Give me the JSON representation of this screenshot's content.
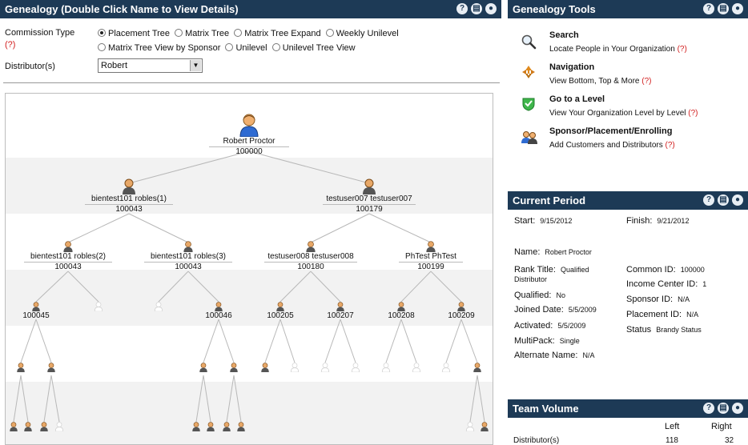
{
  "genealogy": {
    "title": "Genealogy (Double Click Name to View Details)",
    "commission_type_label": "Commission Type",
    "help": "(?)",
    "radios": [
      {
        "label": "Placement Tree",
        "selected": true
      },
      {
        "label": "Matrix Tree",
        "selected": false
      },
      {
        "label": "Matrix Tree Expand",
        "selected": false
      },
      {
        "label": "Weekly Unilevel",
        "selected": false
      },
      {
        "label": "Matrix Tree View by Sponsor",
        "selected": false
      },
      {
        "label": "Unilevel",
        "selected": false
      },
      {
        "label": "Unilevel Tree View",
        "selected": false
      }
    ],
    "distributor_label": "Distributor(s)",
    "distributor_value": "Robert"
  },
  "tree": {
    "root": {
      "name": "Robert Proctor",
      "id": "100000"
    },
    "level1": [
      {
        "name": "bientest101 robles(1)",
        "id": "100043"
      },
      {
        "name": "testuser007 testuser007",
        "id": "100179"
      }
    ],
    "level2": [
      {
        "name": "bientest101 robles(2)",
        "id": "100043"
      },
      {
        "name": "bientest101 robles(3)",
        "id": "100043"
      },
      {
        "name": "testuser008 testuser008",
        "id": "100180"
      },
      {
        "name": "PhTest PhTest",
        "id": "100199"
      }
    ],
    "level3_ids": [
      "100045",
      "100046",
      "100205",
      "100207",
      "100208",
      "100209"
    ]
  },
  "tools": {
    "title": "Genealogy Tools",
    "items": [
      {
        "icon": "search-icon",
        "title": "Search",
        "desc": "Locate People in Your Organization"
      },
      {
        "icon": "navigation-icon",
        "title": "Navigation",
        "desc": "View Bottom, Top & More"
      },
      {
        "icon": "level-icon",
        "title": "Go to a Level",
        "desc": "View Your Organization Level by Level"
      },
      {
        "icon": "people-icon",
        "title": "Sponsor/Placement/Enrolling",
        "desc": "Add Customers and Distributors"
      }
    ]
  },
  "current_period": {
    "title": "Current Period",
    "start_label": "Start:",
    "start_value": "9/15/2012",
    "finish_label": "Finish:",
    "finish_value": "9/21/2012",
    "name_label": "Name:",
    "name_value": "Robert Proctor",
    "rank_label": "Rank Title:",
    "rank_value": "Qualified",
    "rank_value2": "Distributor",
    "qualified_label": "Qualified:",
    "qualified_value": "No",
    "joined_label": "Joined Date:",
    "joined_value": "5/5/2009",
    "activated_label": "Activated:",
    "activated_value": "5/5/2009",
    "multipack_label": "MultiPack:",
    "multipack_value": "Single",
    "alternate_label": "Alternate Name:",
    "alternate_value": "N/A",
    "common_label": "Common ID:",
    "common_value": "100000",
    "income_label": "Income Center ID:",
    "income_value": "1",
    "sponsor_label": "Sponsor ID:",
    "sponsor_value": "N/A",
    "placement_label": "Placement ID:",
    "placement_value": "N/A",
    "status_label": "Status",
    "status_value": "Brandy Status"
  },
  "team_volume": {
    "title": "Team Volume",
    "left_label": "Left",
    "right_label": "Right",
    "row_label": "Distributor(s)",
    "row_left": "118",
    "row_right": "32"
  },
  "colors": {
    "header": "#1d3a56",
    "help": "#d21e1e"
  }
}
